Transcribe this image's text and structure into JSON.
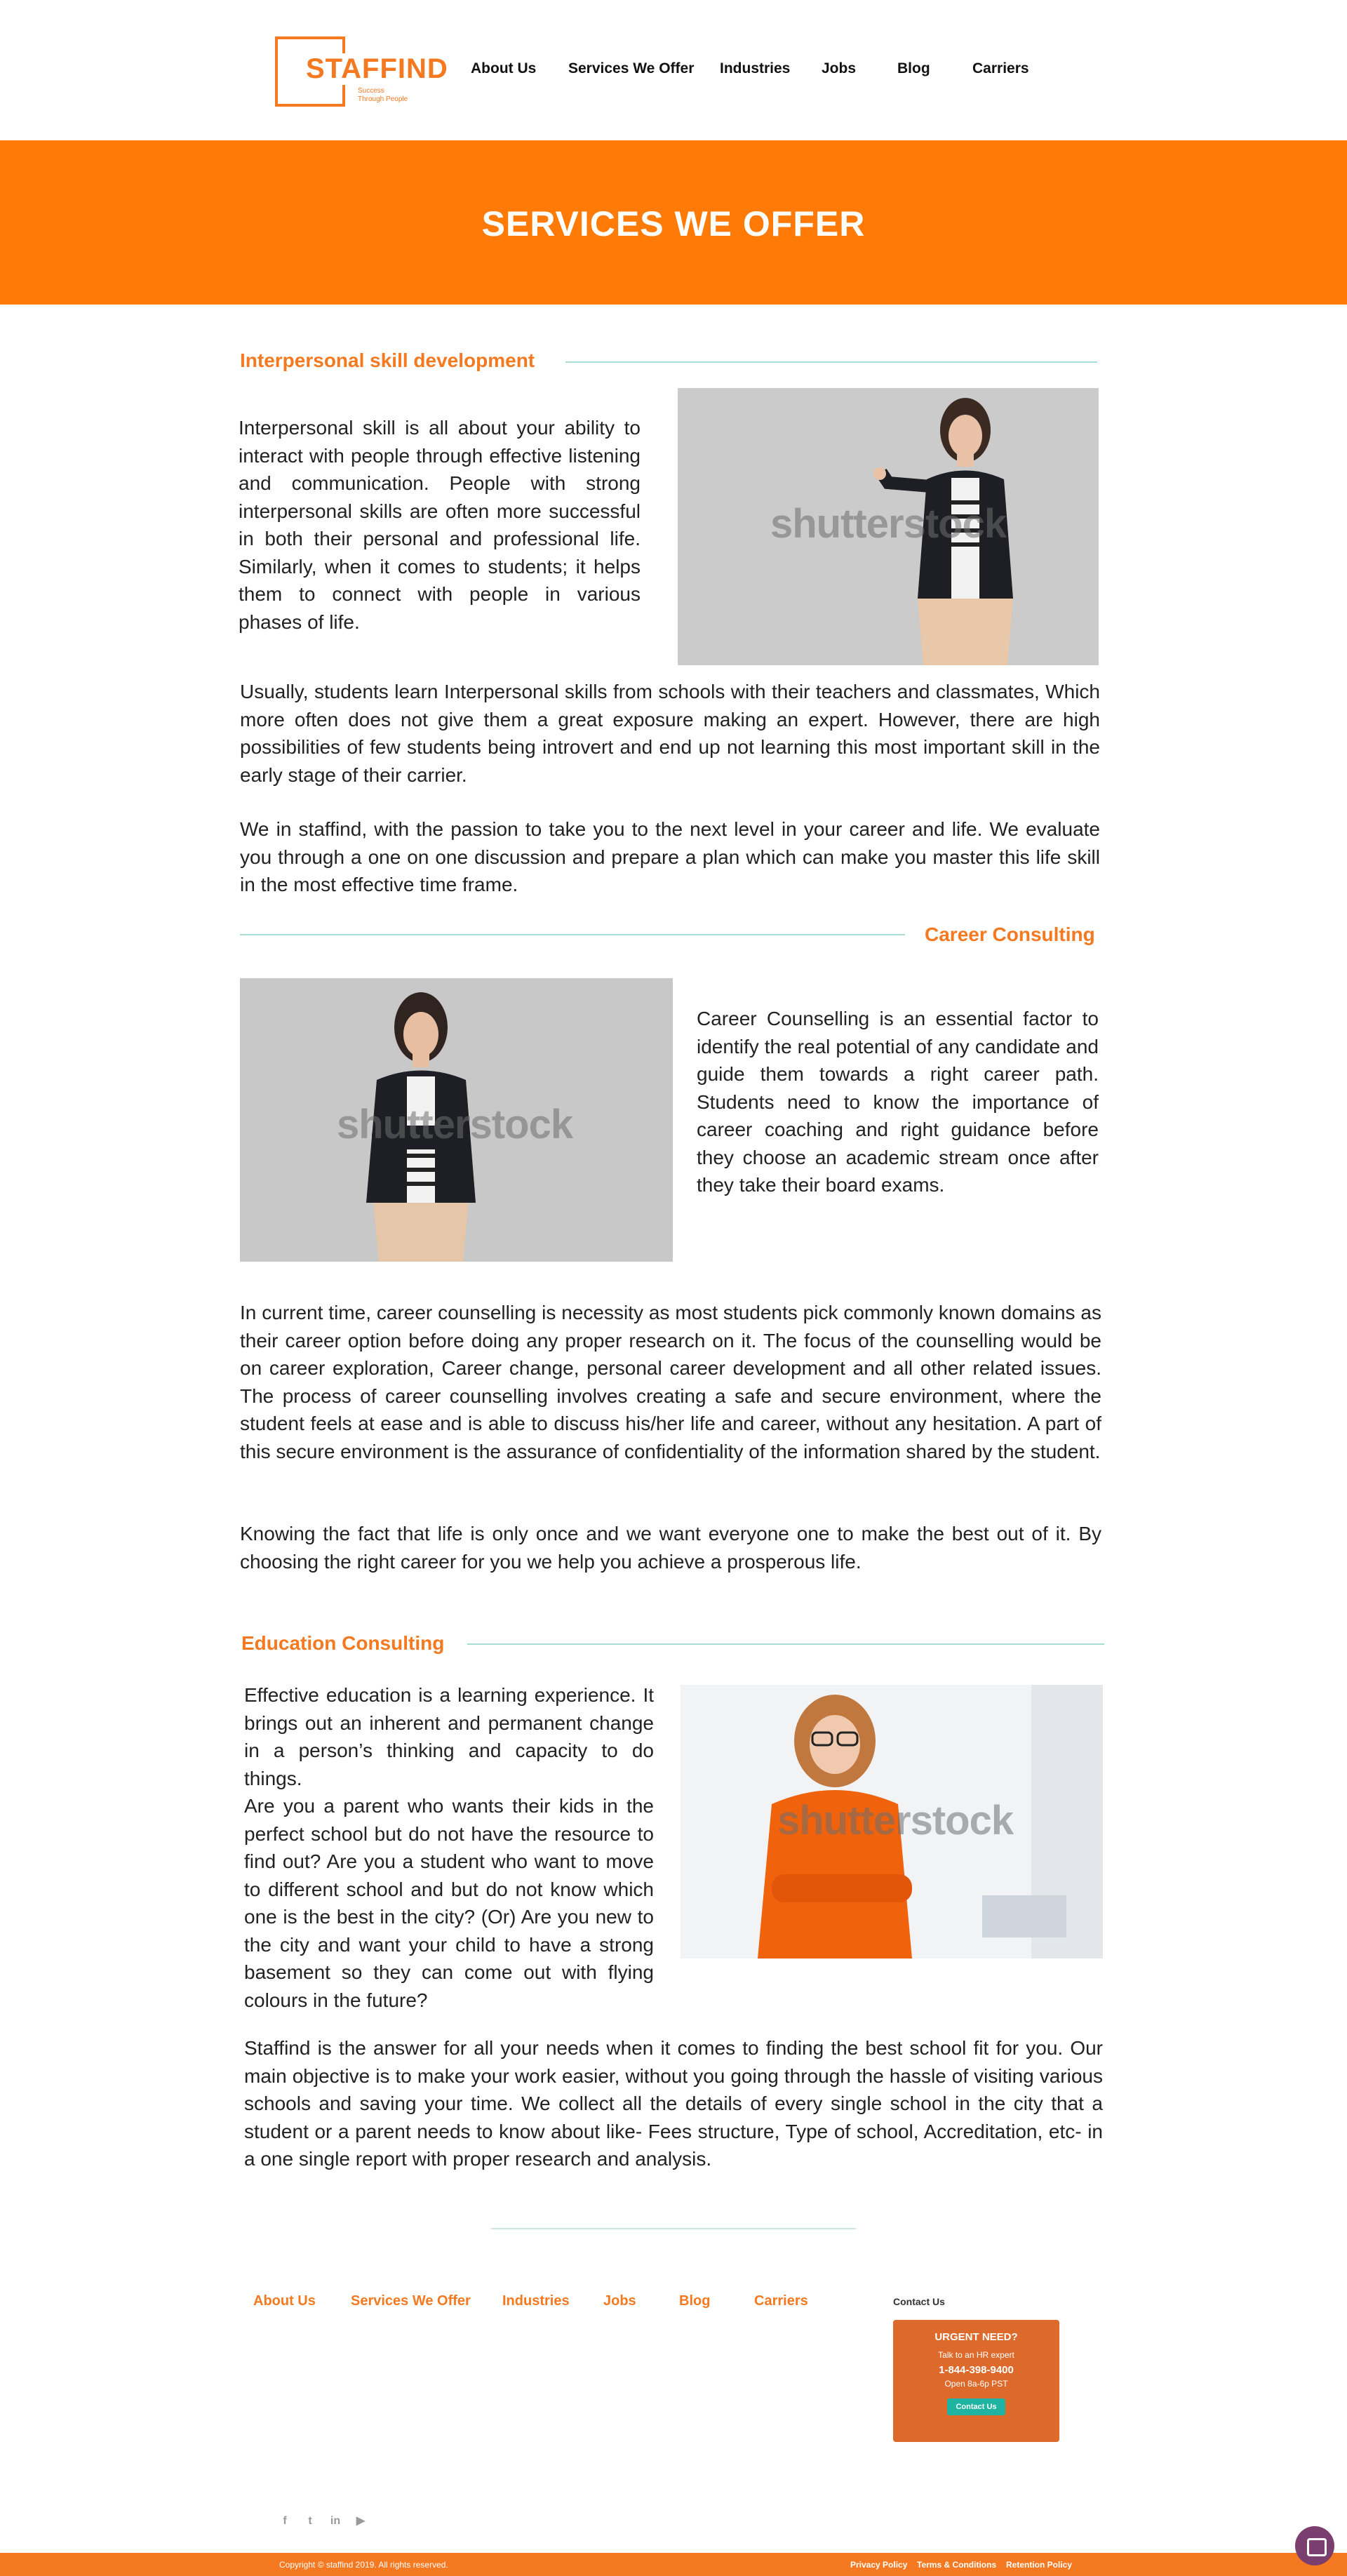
{
  "brand": {
    "logo_text": "STAFFIND",
    "tagline": "Success\nThrough People",
    "accent_color": "#f47920"
  },
  "nav": {
    "items": [
      "About Us",
      "Services We Offer",
      "Industries",
      "Jobs",
      "Blog",
      "Carriers"
    ]
  },
  "hero": {
    "title": "SERVICES WE OFFER",
    "bg_color": "#ff7a06"
  },
  "sections": [
    {
      "title": "Interpersonal skill development",
      "intro": "Interpersonal skill is all about your ability to interact with people through effective listening and communication. People with strong interpersonal skills are often more successful in both their personal and professional life. Similarly, when it comes to students; it helps them to connect with people in various phases of life.",
      "body": [
        "Usually, students learn Interpersonal skills from schools with their teachers and classmates, Which more often does not give them a great exposure making an expert. However, there are high possibilities of few students being introvert and end up not learning this most important skill in the early stage of their carrier.",
        "We in staffind, with the passion to take you to the next level in your career and life. We evaluate you through a one on one discussion and prepare a plan which can make you master this life skill in the most effective time frame."
      ],
      "image_watermark": "shutterstock"
    },
    {
      "title": "Career Consulting",
      "intro": "Career Counselling is an essential factor to identify the real potential of any candidate and guide them towards a right career path. Students need to know the importance of career coaching and right guidance before they choose an academic stream once after they take their board exams.",
      "body": [
        "In current time, career counselling is necessity as most students pick commonly known domains as their career option before doing any proper research on it. The focus of the counselling would be on career exploration, Career change, personal career development and all other related issues. The process of career counselling involves creating a safe and secure environment, where the student feels at ease and is able to discuss his/her life and career, without any hesitation. A part of this secure environment is the assurance of confidentiality of the information shared by the student.",
        "Knowing the fact that life is only once and we want everyone one to make the best out of it. By choosing the right career for you we help you achieve a prosperous life."
      ],
      "image_watermark": "shutterstock"
    },
    {
      "title": "Education Consulting",
      "intro": "Effective education is a learning experience. It brings out an inherent and permanent change in a person’s thinking and capacity to do things.\nAre you a parent who wants their kids in the perfect school but do not have the resource to find out? Are you a student who want to move to different school and but do not know which one is the best in the city? (Or) Are you new to the city and want your child to have a strong basement so they can come out with flying colours in the future?",
      "body": [
        "Staffind is the answer for all your needs when it comes to finding the best school fit for you. Our main objective is to make your work easier, without you going through the hassle of visiting various schools and saving your time. We collect all the details of every single school in the city that a student or a parent needs to know about like- Fees structure, Type of school, Accreditation, etc- in a one single report with proper research and analysis."
      ],
      "image_watermark": "shutterstock"
    }
  ],
  "footer": {
    "nav": [
      "About Us",
      "Services We Offer",
      "Industries",
      "Jobs",
      "Blog",
      "Carriers"
    ],
    "contact_label": "Contact Us",
    "urgent": {
      "title": "URGENT NEED?",
      "subtitle": "Talk to an HR expert",
      "phone": "1-844-398-9400",
      "hours": "Open 8a-6p PST",
      "button": "Contact Us"
    },
    "social_icons": [
      "facebook-icon",
      "twitter-icon",
      "linkedin-icon",
      "youtube-icon"
    ],
    "copyright": "Copyright © staffind 2019. All rights reserved.",
    "legal": [
      "Privacy Policy",
      "Terms & Conditions",
      "Retention Policy"
    ]
  }
}
